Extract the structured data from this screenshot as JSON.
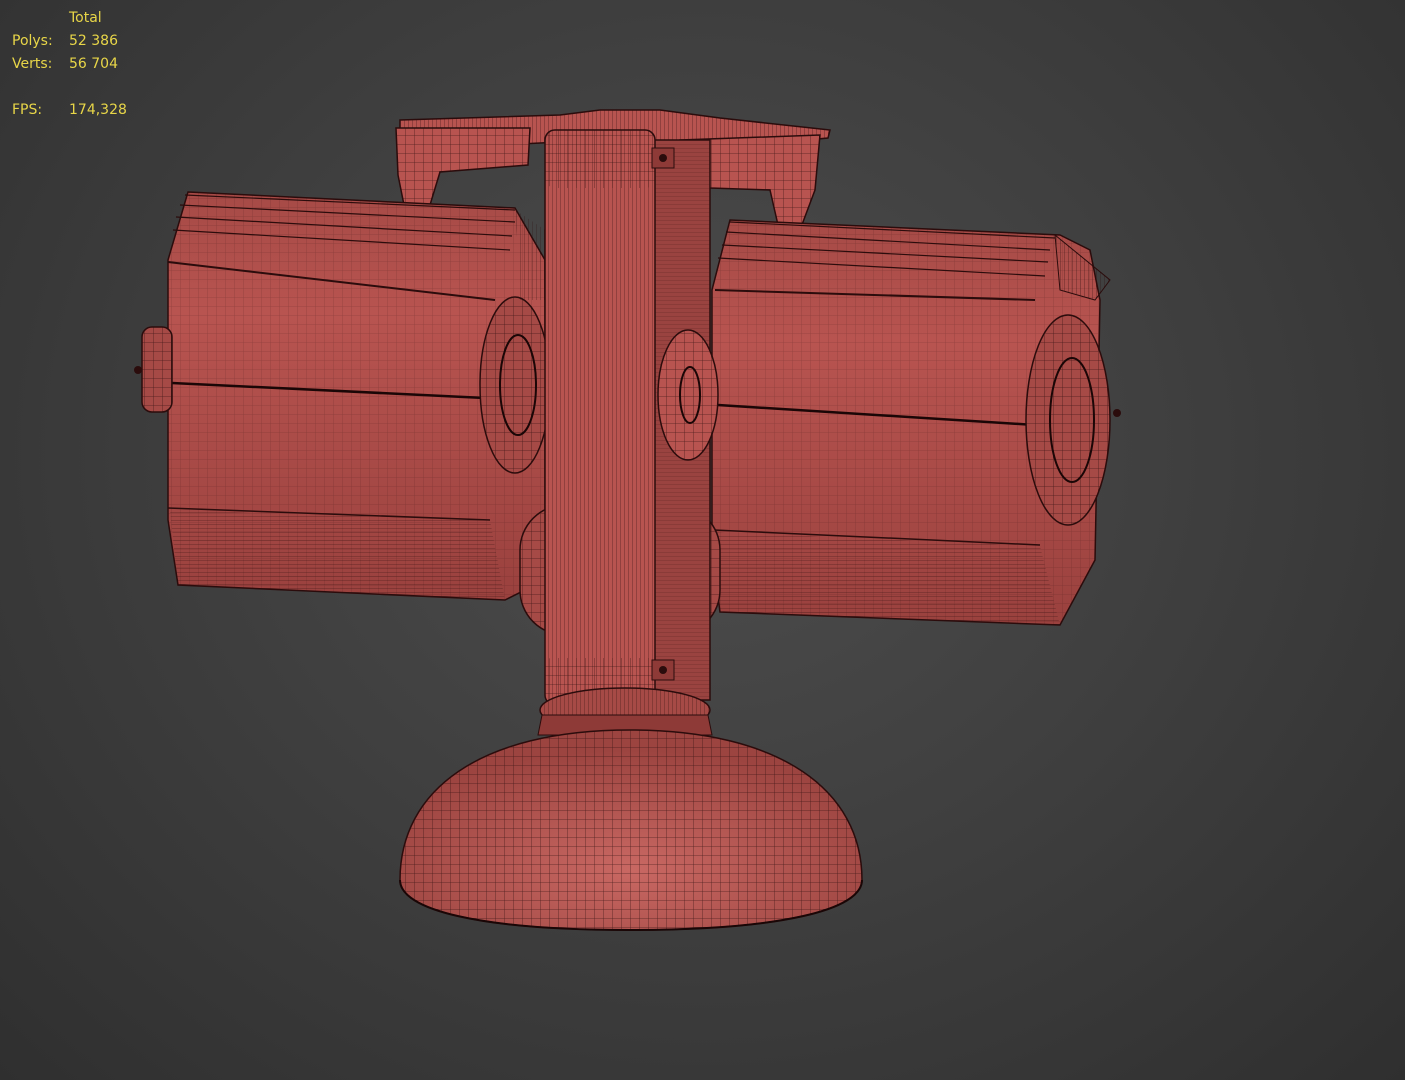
{
  "stats": {
    "header": "Total",
    "polys_label": "Polys:",
    "polys_value": "52 386",
    "verts_label": "Verts:",
    "verts_value": "56 704",
    "fps_label": "FPS:",
    "fps_value": "174,328"
  },
  "colors": {
    "stats_text": "#e8d648",
    "mesh_fill": "#b85450",
    "mesh_dark": "#8e3a37",
    "wire": "#2b0c0c",
    "background": "#404040"
  }
}
